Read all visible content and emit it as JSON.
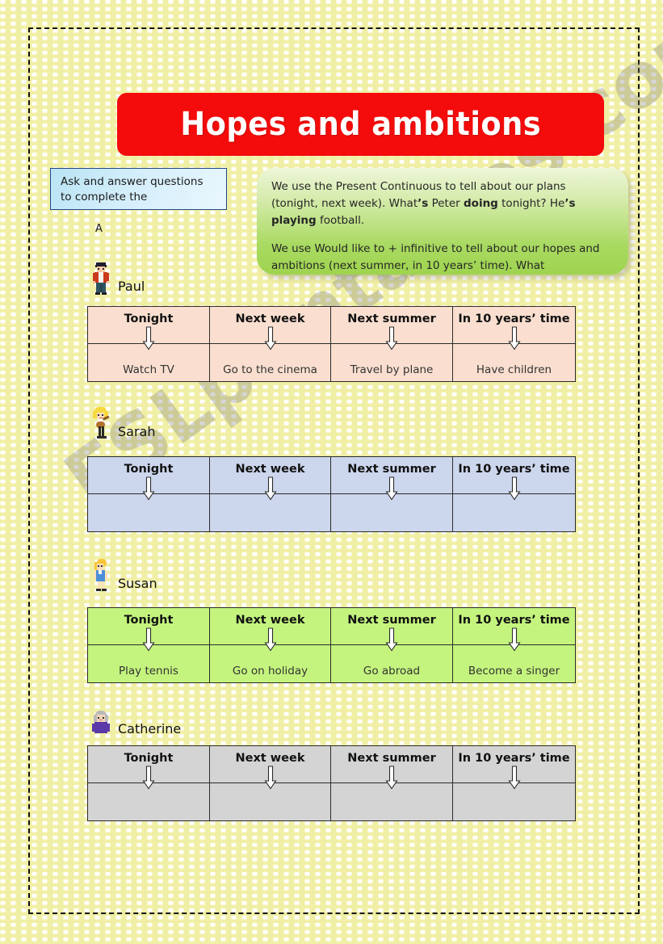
{
  "page": {
    "title": "Hopes and ambitions",
    "section_letter": "A",
    "watermark": "ESLprintables.com"
  },
  "instruction_box": {
    "line1": "Ask and answer questions",
    "line2": "to complete the"
  },
  "grammar_box": {
    "paragraph1_part1": "We use the Present Continuous to tell about our plans (tonight, next week). What",
    "paragraph1_bold1": "’s",
    "paragraph1_part2": " Peter ",
    "paragraph1_bold2": "doing",
    "paragraph1_part3": " tonight?  He",
    "paragraph1_bold3": "’s",
    "paragraph1_part4": " ",
    "paragraph1_bold4": "playing",
    "paragraph1_part5": " football.",
    "paragraph2": "We use Would like to + infinitive to tell about our hopes and ambitions (next summer, in 10 years’ time).  What"
  },
  "columns": [
    "Tonight",
    "Next week",
    "Next summer",
    "In 10 years’ time"
  ],
  "people": [
    {
      "name": "Paul",
      "avatar": "boy-red-jacket-icon",
      "table_color": "#fadfd0",
      "values": [
        "Watch TV",
        "Go to the cinema",
        "Travel by plane",
        "Have children"
      ]
    },
    {
      "name": "Sarah",
      "avatar": "girl-with-guitar-icon",
      "table_color": "#ccd6ec",
      "values": [
        "",
        "",
        "",
        ""
      ]
    },
    {
      "name": "Susan",
      "avatar": "girl-blue-dress-icon",
      "table_color": "#c4f47e",
      "values": [
        "Play tennis",
        "Go on holiday",
        "Go abroad",
        "Become a singer"
      ]
    },
    {
      "name": "Catherine",
      "avatar": "older-woman-icon",
      "table_color": "#d4d4d4",
      "values": [
        "",
        "",
        "",
        ""
      ]
    }
  ],
  "colors": {
    "title_banner": "#f40b0b",
    "title_text": "#ffffff",
    "instruction_border": "#21468c",
    "page_background": "#fffdf0",
    "frame": "#111111"
  }
}
